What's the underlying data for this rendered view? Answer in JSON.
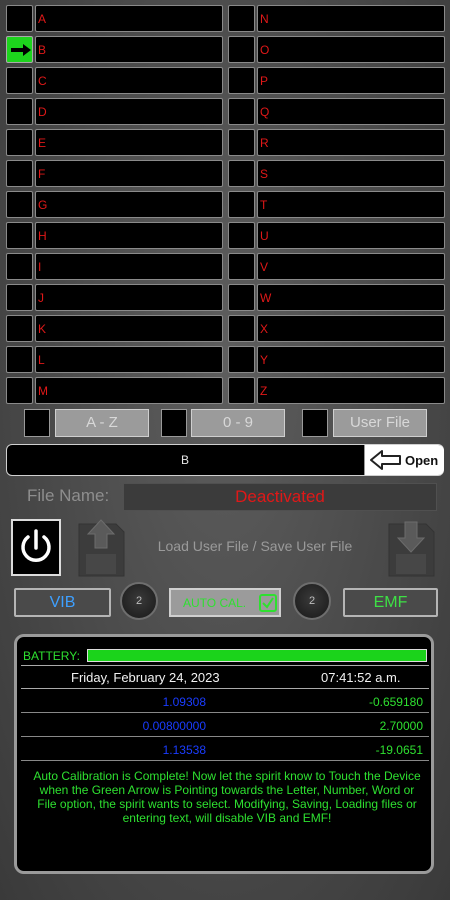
{
  "letters_left": [
    "A",
    "B",
    "C",
    "D",
    "E",
    "F",
    "G",
    "H",
    "I",
    "J",
    "K",
    "L",
    "M"
  ],
  "letters_right": [
    "N",
    "O",
    "P",
    "Q",
    "R",
    "S",
    "T",
    "U",
    "V",
    "W",
    "X",
    "Y",
    "Z"
  ],
  "selected_letter_index": 1,
  "selectors": {
    "az_label": "A - Z",
    "digits_label": "0 - 9",
    "user_file_label": "User File"
  },
  "display": {
    "value": "B",
    "open_label": "Open"
  },
  "file": {
    "label": "File Name:",
    "status": "Deactivated"
  },
  "load_save_label": "Load User File / Save User File",
  "controls": {
    "vib_label": "VIB",
    "emf_label": "EMF",
    "left_counter": "2",
    "right_counter": "2",
    "autocal_label": "AUTO CAL."
  },
  "status_panel": {
    "battery_label": "BATTERY:",
    "battery_level": 1.0,
    "date": "Friday, February 24, 2023",
    "time": "07:41:52 a.m.",
    "readings": [
      {
        "left": "1.09308",
        "right": "-0.659180"
      },
      {
        "left": "0.00800000",
        "right": "2.70000"
      },
      {
        "left": "1.13538",
        "right": "-19.0651"
      }
    ],
    "message": "Auto Calibration is Complete! Now let the spirit know to Touch the Device when the Green Arrow is Pointing towards the Letter, Number, Word or File option, the spirit wants to select. Modifying, Saving, Loading files or entering text, will disable VIB and EMF!"
  },
  "colors": {
    "letter": "#e01818",
    "accent_green": "#2ee030",
    "accent_blue": "#3ea0ff"
  }
}
